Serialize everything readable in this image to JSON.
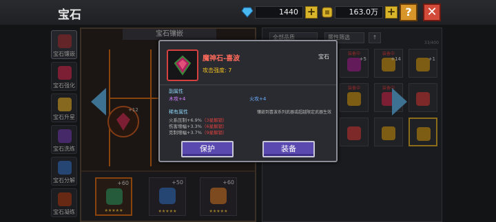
{
  "header": {
    "title": "宝石",
    "diamonds": "1440",
    "gold": "163.0万",
    "help_label": "?",
    "close_label": "✕",
    "plus_label": "+"
  },
  "side_tabs": [
    {
      "label": "宝石镶嵌",
      "color": "#9a3a40"
    },
    {
      "label": "宝石强化",
      "color": "#c03050"
    },
    {
      "label": "宝石升星",
      "color": "#d0a030"
    },
    {
      "label": "宝石洗练",
      "color": "#6a40a0"
    },
    {
      "label": "宝石分解",
      "color": "#3a6ab0"
    },
    {
      "label": "宝石凝练",
      "color": "#a04020"
    }
  ],
  "inlay_panel": {
    "title": "宝石镶嵌",
    "slot_plus": "+12",
    "bottom_slots": [
      {
        "plus": "+60",
        "stars": "★★★★★"
      },
      {
        "plus": "+50",
        "stars": "★★★★★"
      },
      {
        "plus": "+60",
        "stars": "★★★★★"
      }
    ]
  },
  "inventory": {
    "filter_all": "全部品质",
    "filter_attr": "属性筛选",
    "sort_icon": "↑",
    "count": "33/400",
    "equipped_label": "装备中",
    "items": [
      {
        "eq": "",
        "num": "+7",
        "color": "#c03030"
      },
      {
        "eq": "装备中",
        "num": "+7",
        "color": "#b03040"
      },
      {
        "eq": "装备中",
        "num": "+5",
        "color": "#9a2a8a"
      },
      {
        "eq": "装备中",
        "num": "+14",
        "color": "#c09020"
      },
      {
        "eq": "",
        "num": "+1",
        "color": "#c09020"
      },
      {
        "eq": "装备中",
        "num": "",
        "color": "#a03080"
      },
      {
        "eq": "装备中",
        "num": "",
        "color": "#6a3aa0"
      },
      {
        "eq": "装备中",
        "num": "",
        "color": "#c09020"
      },
      {
        "eq": "装备中",
        "num": "",
        "color": "#c03050"
      },
      {
        "eq": "",
        "num": "",
        "color": "#c04040"
      },
      {
        "eq": "",
        "num": "",
        "color": "#c09020"
      },
      {
        "eq": "",
        "num": "",
        "color": "#c09020"
      },
      {
        "eq": "",
        "num": "",
        "color": "#c04040"
      },
      {
        "eq": "",
        "num": "",
        "color": "#c09020"
      },
      {
        "eq": "",
        "num": "",
        "color": "#c09020"
      }
    ]
  },
  "popup": {
    "name": "魔神石-喜波",
    "type": "宝石",
    "attack": "攻击强度: 7",
    "sub_attr_title": "副属性",
    "sub_attr_1": "木攻+4",
    "sub_attr_2": "火攻+4",
    "rare_attr_title": "稀有属性",
    "rare_note": "镶嵌到喜波系列武器或超越限定武器生效",
    "rare_attrs": [
      {
        "text": "火系压制+6.9%",
        "lock": "（3星解锁）"
      },
      {
        "text": "伤害增幅+3.3%",
        "lock": "（6星解锁）"
      },
      {
        "text": "克制增幅+3.7%",
        "lock": "（9星解锁）"
      }
    ],
    "protect_label": "保护",
    "equip_label": "装备"
  }
}
